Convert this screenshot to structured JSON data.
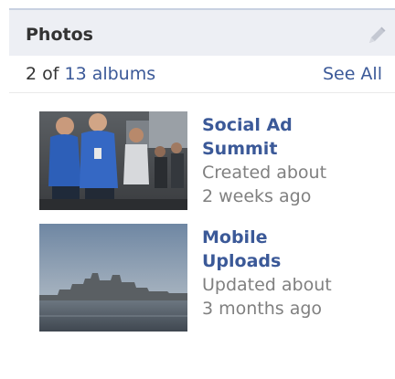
{
  "header": {
    "title": "Photos",
    "edit_icon": "pencil-icon"
  },
  "subbar": {
    "prefix": "2 of ",
    "albums_link": "13 albums",
    "see_all": "See All"
  },
  "albums": [
    {
      "title_line1": "Social Ad",
      "title_line2": "Summit",
      "meta_line1": "Created about",
      "meta_line2": "2 weeks ago",
      "thumb_icon": "event-photo-thumbnail"
    },
    {
      "title_line1": "Mobile",
      "title_line2": "Uploads",
      "meta_line1": "Updated about",
      "meta_line2": "3 months ago",
      "thumb_icon": "city-skyline-thumbnail"
    }
  ],
  "colors": {
    "link": "#3b5998",
    "header_bg": "#edeff4",
    "meta_text": "#808080"
  }
}
